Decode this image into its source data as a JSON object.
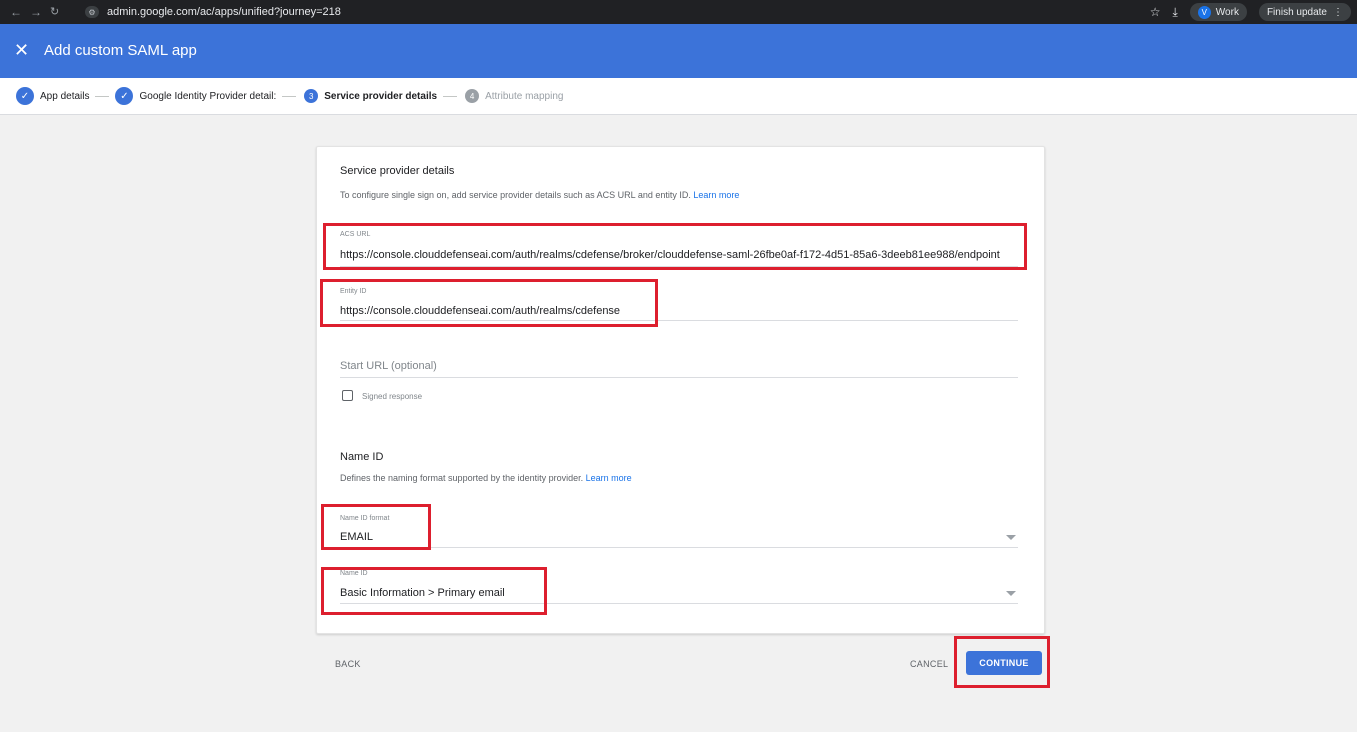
{
  "browser": {
    "url": "admin.google.com/ac/apps/unified?journey=218",
    "back_icon": "arrow-left-icon",
    "forward_icon": "arrow-right-icon",
    "reload_icon": "reload-icon",
    "profile_initial": "V",
    "profile_label": "Work",
    "update_label": "Finish update"
  },
  "appbar": {
    "close_glyph": "✕",
    "title": "Add custom SAML app"
  },
  "stepper": {
    "steps": [
      {
        "label": "App details",
        "state": "done"
      },
      {
        "label": "Google Identity Provider detail:",
        "state": "done"
      },
      {
        "number": "3",
        "label": "Service provider details",
        "state": "active"
      },
      {
        "number": "4",
        "label": "Attribute mapping",
        "state": "disabled"
      }
    ]
  },
  "card": {
    "title": "Service provider details",
    "description": "To configure single sign on, add service provider details such as ACS URL and entity ID.",
    "learn_more": "Learn more",
    "acs_url": {
      "label": "ACS URL",
      "value": "https://console.clouddefenseai.com/auth/realms/cdefense/broker/clouddefense-saml-26fbe0af-f172-4d51-85a6-3deeb81ee988/endpoint"
    },
    "entity_id": {
      "label": "Entity ID",
      "value": "https://console.clouddefenseai.com/auth/realms/cdefense"
    },
    "start_url": {
      "placeholder": "Start URL (optional)"
    },
    "signed_response": {
      "label": "Signed response",
      "checked": false
    },
    "name_id_section": {
      "title": "Name ID",
      "description": "Defines the naming format supported by the identity provider.",
      "learn_more": "Learn more"
    },
    "name_id_format": {
      "label": "Name ID format",
      "value": "EMAIL"
    },
    "name_id": {
      "label": "Name ID",
      "value": "Basic Information > Primary email"
    }
  },
  "actions": {
    "back": "BACK",
    "cancel": "CANCEL",
    "continue": "CONTINUE"
  },
  "colors": {
    "appbar": "#3c73d9",
    "highlight": "#dd1f2e",
    "link": "#1a73e8"
  }
}
